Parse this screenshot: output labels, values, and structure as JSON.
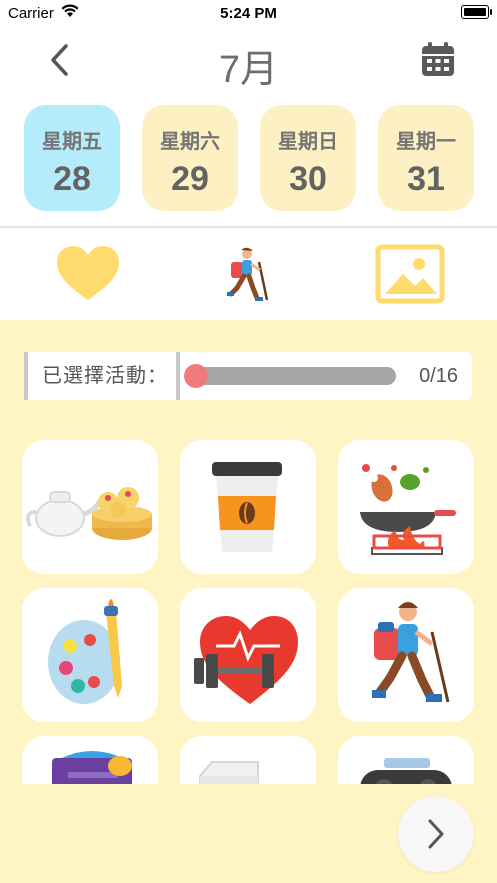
{
  "status_bar": {
    "carrier": "Carrier",
    "time": "5:24 PM"
  },
  "header": {
    "month": "7月"
  },
  "days": [
    {
      "weekday": "星期五",
      "date": "28",
      "selected": true
    },
    {
      "weekday": "星期六",
      "date": "29",
      "selected": false
    },
    {
      "weekday": "星期日",
      "date": "30",
      "selected": false
    },
    {
      "weekday": "星期一",
      "date": "31",
      "selected": false
    }
  ],
  "tabs": [
    {
      "icon": "heart-icon"
    },
    {
      "icon": "hiker-icon"
    },
    {
      "icon": "image-icon"
    }
  ],
  "progress": {
    "label": "已選擇活動：",
    "count": "0/16",
    "value": 0
  },
  "activities": [
    {
      "icon": "dim-sum-tea-icon"
    },
    {
      "icon": "coffee-cup-icon"
    },
    {
      "icon": "cooking-pan-icon"
    },
    {
      "icon": "paint-palette-icon"
    },
    {
      "icon": "heart-dumbbell-icon"
    },
    {
      "icon": "hiker-icon"
    },
    {
      "icon": "card-leaf-icon"
    },
    {
      "icon": "paper-stack-icon"
    },
    {
      "icon": "radio-icon"
    }
  ],
  "colors": {
    "selected_day": "#b5ecfc",
    "day": "#fdf0c2",
    "content_bg": "#fff5c4",
    "progress_fill": "#f07b7b"
  }
}
